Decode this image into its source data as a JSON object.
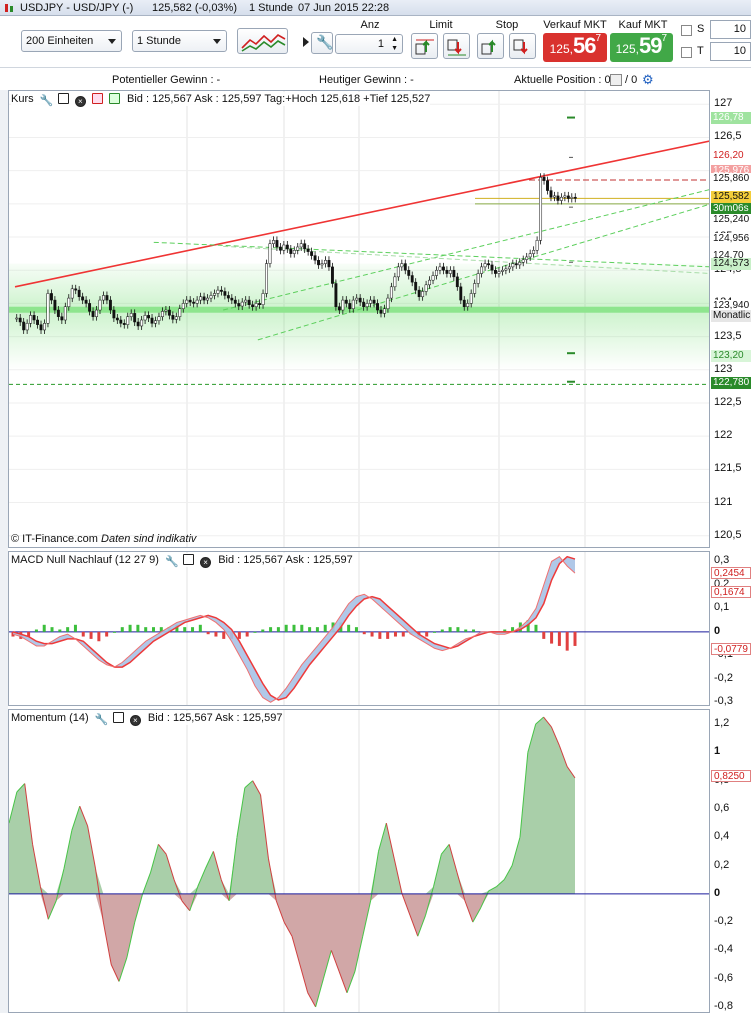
{
  "window": {
    "symbol": "USDJPY - USD/JPY (-)",
    "last": "125,582 (-0,03%)",
    "interval": "1 Stunde",
    "datetime": "07 Jun 2015 22:28"
  },
  "toolbar": {
    "units_select": "200 Einheiten",
    "interval_select": "1 Stunde",
    "qty_label": "Anz",
    "qty_value": "1",
    "limit_label": "Limit",
    "stop_label": "Stop",
    "sell_label": "Verkauf MKT",
    "buy_label": "Kauf MKT",
    "sell_price": {
      "small": "125,",
      "big": "56",
      "sup": "7"
    },
    "buy_price": {
      "small": "125,",
      "big": "59",
      "sup": "7"
    },
    "s_label": "S",
    "t_label": "T",
    "s_value": "10",
    "t_value": "10"
  },
  "status": {
    "potential_gain": "Potentieller Gewinn : -",
    "today_gain": "Heutiger Gewinn : -",
    "position": "Aktuelle Position : 0",
    "position_b": "/ 0"
  },
  "colors": {
    "up": "#2a8a2a",
    "down": "#d02020",
    "trend": "#ef3434",
    "channel": "#5ccf5c",
    "zero": "#1a1a9c",
    "macd_fill": "#a7c2e6",
    "osc_pos": "#a9cfa9",
    "osc_neg": "#d1a7a7"
  },
  "main_panel": {
    "name": "Kurs",
    "quote": "Bid : 125,567 Ask : 125,597 Tag:+Hoch 125,618 +Tief 125,527",
    "footer": "© IT-Finance.com",
    "footer_note": "Daten sind indikativ"
  },
  "price_scale": [
    "127",
    "126,5",
    "126",
    "125,5",
    "125",
    "124,5",
    "124",
    "123,5",
    "123",
    "122,5",
    "122",
    "121,5",
    "121",
    "120,5"
  ],
  "price_tags": [
    {
      "text": "126,78",
      "bg": "#9fe39f",
      "fg": "#ffffff",
      "price": 126.78
    },
    {
      "text": "126,20",
      "bg": "#ffffff",
      "fg": "#d02020",
      "price": 126.2
    },
    {
      "text": "125,976",
      "bg": "#f3a0a0",
      "fg": "#ffffff",
      "price": 125.976
    },
    {
      "text": "125,860",
      "bg": "#ffffff",
      "fg": "#111111",
      "price": 125.86
    },
    {
      "text": "125,582",
      "bg": "#f3cd3a",
      "fg": "#111111",
      "price": 125.582
    },
    {
      "text": "30m06s",
      "bg": "#2a8a2a",
      "fg": "#ffffff",
      "price": 125.4
    },
    {
      "text": "125,240",
      "bg": "#ffffff",
      "fg": "#111111",
      "price": 125.24
    },
    {
      "text": "124,956",
      "bg": "#ffffff",
      "fg": "#111111",
      "price": 124.956
    },
    {
      "text": "124,70",
      "bg": "#ffffff",
      "fg": "#111111",
      "price": 124.7
    },
    {
      "text": "124,573",
      "bg": "#c8f0c8",
      "fg": "#111111",
      "price": 124.573
    },
    {
      "text": "123,940",
      "bg": "#ffffff",
      "fg": "#111111",
      "price": 123.94
    },
    {
      "text": "Monatlic",
      "bg": "#e6e6e6",
      "fg": "#111111",
      "price": 123.8
    },
    {
      "text": "123,20",
      "bg": "#d8f5d8",
      "fg": "#2a8a2a",
      "price": 123.2
    },
    {
      "text": "122,780",
      "bg": "#2a8a2a",
      "fg": "#ffffff",
      "price": 122.78
    }
  ],
  "macd_panel": {
    "name": "MACD Null Nachlauf (12 27 9)",
    "quote": "Bid : 125,567 Ask : 125,597"
  },
  "macd_scale": [
    "0,3",
    "0,2",
    "0,1",
    "0",
    "-0,1",
    "-0,2",
    "-0,3"
  ],
  "macd_tags": [
    {
      "text": "0,2454",
      "value": 0.2454,
      "fg": "#d02020"
    },
    {
      "text": "0,1674",
      "value": 0.1674,
      "fg": "#d02020"
    },
    {
      "text": "-0,0779",
      "value": -0.0779,
      "fg": "#d02020"
    }
  ],
  "mom_panel": {
    "name": "Momentum (14)",
    "quote": "Bid : 125,567 Ask : 125,597"
  },
  "mom_scale": [
    "1,2",
    "1",
    "0,8",
    "0,6",
    "0,4",
    "0,2",
    "0",
    "-0,2",
    "-0,4",
    "-0,6",
    "-0,8"
  ],
  "mom_tag": {
    "text": "0,8250",
    "value": 0.825
  },
  "chart_data": [
    {
      "type": "candlestick",
      "title": "USDJPY - USD/JPY (-)",
      "interval": "1 Stunde",
      "ylim": [
        120.3,
        127.2
      ],
      "close": [
        123.78,
        123.72,
        123.6,
        123.7,
        123.82,
        123.75,
        123.68,
        123.6,
        123.7,
        124.15,
        124.05,
        123.9,
        123.8,
        123.75,
        123.95,
        124.08,
        124.22,
        124.2,
        124.1,
        124.05,
        124.0,
        123.88,
        123.8,
        123.9,
        124.05,
        124.12,
        124.05,
        123.9,
        123.78,
        123.75,
        123.7,
        123.68,
        123.8,
        123.85,
        123.72,
        123.66,
        123.75,
        123.82,
        123.78,
        123.7,
        123.74,
        123.8,
        123.88,
        123.9,
        123.82,
        123.76,
        123.8,
        123.92,
        124.0,
        124.05,
        124.02,
        124.0,
        124.05,
        124.1,
        124.05,
        124.08,
        124.12,
        124.15,
        124.2,
        124.18,
        124.12,
        124.08,
        124.05,
        124.0,
        123.96,
        124.02,
        124.05,
        123.98,
        123.95,
        124.0,
        123.98,
        124.15,
        124.6,
        124.9,
        124.95,
        124.85,
        124.8,
        124.88,
        124.82,
        124.75,
        124.8,
        124.85,
        124.9,
        124.82,
        124.78,
        124.72,
        124.65,
        124.58,
        124.6,
        124.65,
        124.55,
        124.3,
        123.95,
        123.9,
        124.05,
        124.0,
        123.92,
        124.05,
        124.08,
        124.02,
        123.95,
        124.0,
        124.05,
        124.0,
        123.9,
        123.85,
        123.92,
        124.08,
        124.25,
        124.4,
        124.55,
        124.6,
        124.5,
        124.42,
        124.32,
        124.2,
        124.1,
        124.18,
        124.28,
        124.35,
        124.42,
        124.5,
        124.55,
        124.5,
        124.45,
        124.5,
        124.4,
        124.25,
        124.05,
        123.95,
        124.0,
        124.15,
        124.3,
        124.45,
        124.55,
        124.6,
        124.58,
        124.5,
        124.45,
        124.48,
        124.5,
        124.52,
        124.55,
        124.6,
        124.58,
        124.62,
        124.66,
        124.7,
        124.75,
        124.8,
        124.95,
        125.9,
        125.85,
        125.7,
        125.6,
        125.62,
        125.55,
        125.6,
        125.62,
        125.58,
        125.6,
        125.582
      ]
    },
    {
      "type": "line",
      "title": "MACD Null Nachlauf (12 27 9)",
      "ylim": [
        -0.32,
        0.34
      ],
      "series": [
        {
          "values": [
            -0.01,
            -0.02,
            -0.04,
            -0.06,
            -0.06,
            -0.04,
            -0.02,
            -0.01,
            -0.03,
            -0.06,
            -0.09,
            -0.12,
            -0.14,
            -0.15,
            -0.13,
            -0.1,
            -0.07,
            -0.04,
            -0.02,
            0.0,
            0.02,
            0.04,
            0.05,
            0.06,
            0.07,
            0.06,
            0.04,
            0.01,
            -0.04,
            -0.1,
            -0.16,
            -0.23,
            -0.28,
            -0.3,
            -0.28,
            -0.24,
            -0.19,
            -0.14,
            -0.1,
            -0.06,
            -0.02,
            0.02,
            0.07,
            0.12,
            0.15,
            0.16,
            0.14,
            0.11,
            0.08,
            0.05,
            0.02,
            -0.01,
            -0.03,
            -0.05,
            -0.07,
            -0.08,
            -0.07,
            -0.05,
            -0.03,
            -0.02,
            0.0,
            0.0,
            -0.01,
            -0.01,
            0.0,
            0.02,
            0.05,
            0.1,
            0.2,
            0.3,
            0.32,
            0.28,
            0.25
          ]
        },
        {
          "values": [
            0.0,
            -0.01,
            -0.02,
            -0.04,
            -0.05,
            -0.05,
            -0.04,
            -0.03,
            -0.03,
            -0.04,
            -0.07,
            -0.1,
            -0.13,
            -0.15,
            -0.15,
            -0.13,
            -0.1,
            -0.07,
            -0.04,
            -0.02,
            0.0,
            0.02,
            0.04,
            0.05,
            0.06,
            0.07,
            0.06,
            0.04,
            0.01,
            -0.04,
            -0.1,
            -0.16,
            -0.22,
            -0.27,
            -0.29,
            -0.28,
            -0.24,
            -0.19,
            -0.14,
            -0.1,
            -0.06,
            -0.02,
            0.02,
            0.07,
            0.11,
            0.14,
            0.15,
            0.14,
            0.11,
            0.08,
            0.05,
            0.02,
            -0.01,
            -0.03,
            -0.05,
            -0.06,
            -0.07,
            -0.06,
            -0.04,
            -0.02,
            -0.01,
            0.0,
            0.0,
            0.0,
            0.0,
            0.01,
            0.03,
            0.06,
            0.12,
            0.22,
            0.29,
            0.32,
            0.31
          ]
        }
      ],
      "histogram": [
        -0.02,
        -0.03,
        -0.02,
        0.01,
        0.03,
        0.02,
        0.01,
        0.02,
        0.03,
        -0.02,
        -0.03,
        -0.04,
        -0.02,
        0.0,
        0.02,
        0.03,
        0.03,
        0.02,
        0.02,
        0.02,
        0.02,
        0.03,
        0.02,
        0.02,
        0.03,
        -0.01,
        -0.02,
        -0.03,
        -0.03,
        -0.03,
        -0.02,
        0.0,
        0.01,
        0.02,
        0.02,
        0.03,
        0.03,
        0.03,
        0.02,
        0.02,
        0.03,
        0.04,
        0.04,
        0.03,
        0.02,
        -0.01,
        -0.02,
        -0.03,
        -0.03,
        -0.02,
        -0.02,
        -0.01,
        -0.02,
        -0.02,
        0.0,
        0.01,
        0.02,
        0.02,
        0.01,
        0.01,
        0.0,
        0.0,
        0.0,
        0.01,
        0.02,
        0.04,
        0.05,
        0.03,
        -0.03,
        -0.05,
        -0.06,
        -0.08,
        -0.06
      ]
    },
    {
      "type": "area",
      "title": "Momentum (14)",
      "ylim": [
        -0.85,
        1.3
      ],
      "values": [
        0.5,
        0.72,
        0.78,
        0.35,
        0.05,
        -0.18,
        -0.05,
        0.18,
        0.45,
        0.62,
        0.48,
        0.18,
        -0.2,
        -0.5,
        -0.62,
        -0.45,
        -0.2,
        0.0,
        0.15,
        0.35,
        0.28,
        0.1,
        -0.05,
        -0.12,
        0.05,
        0.18,
        0.3,
        0.1,
        -0.05,
        0.4,
        0.75,
        0.8,
        0.7,
        0.25,
        -0.05,
        -0.2,
        -0.3,
        -0.5,
        -0.7,
        -0.8,
        -0.6,
        -0.4,
        -0.55,
        -0.7,
        -0.55,
        -0.3,
        -0.05,
        0.3,
        0.5,
        0.25,
        0.0,
        -0.15,
        -0.3,
        -0.15,
        0.05,
        0.28,
        0.35,
        0.15,
        -0.05,
        -0.2,
        -0.1,
        0.02,
        0.05,
        0.1,
        0.2,
        0.4,
        1.0,
        1.2,
        1.25,
        1.18,
        1.05,
        0.9,
        0.82
      ]
    }
  ]
}
